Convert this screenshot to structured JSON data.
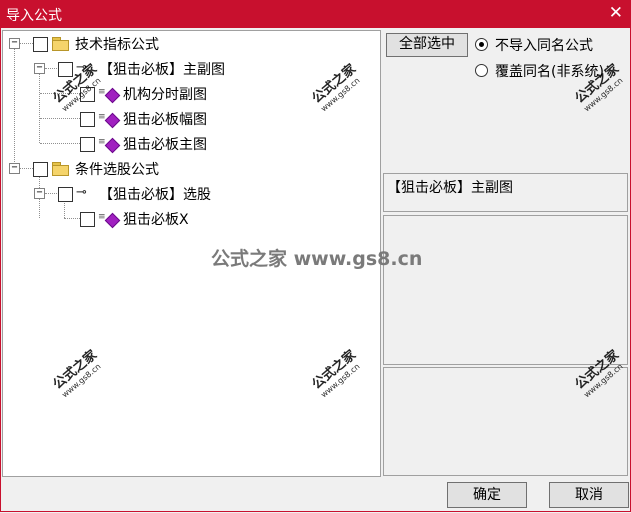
{
  "window": {
    "title": "导入公式",
    "close_symbol": "✕"
  },
  "tree": {
    "nodes": [
      {
        "label": "技术指标公式",
        "expander": "−"
      },
      {
        "label": "【狙击必板】主副图",
        "expander": "−"
      },
      {
        "label": "机构分时副图"
      },
      {
        "label": "狙击必板幅图"
      },
      {
        "label": "狙击必板主图"
      },
      {
        "label": "条件选股公式",
        "expander": "−"
      },
      {
        "label": "【狙击必板】选股",
        "expander": "−"
      },
      {
        "label": "狙击必板X"
      }
    ]
  },
  "right": {
    "select_all_label": "全部选中",
    "radio_skip_label": "不导入同名公式",
    "radio_overwrite_label": "覆盖同名(非系统)",
    "selected_formula": "【狙击必板】主副图"
  },
  "footer": {
    "ok_label": "确定",
    "cancel_label": "取消"
  },
  "watermark": {
    "cn": "公式之家",
    "url": "www.gs8.cn",
    "center": "公式之家 www.gs8.cn"
  },
  "colors": {
    "titlebar": "#c8102e",
    "gem": "#a020c0",
    "folder": "#f5d46b"
  },
  "icons": [
    "folder-icon",
    "key-icon",
    "gem-icon",
    "close-icon"
  ]
}
